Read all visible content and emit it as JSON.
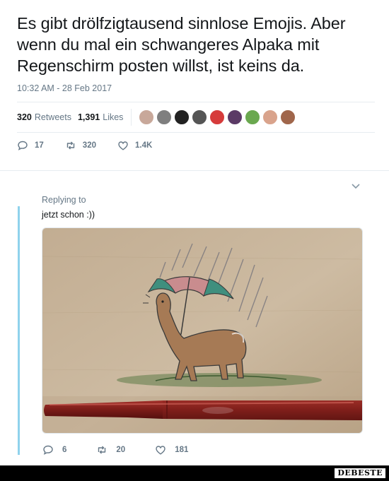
{
  "tweet": {
    "text": "Es gibt drölfzigtausend sinnlose Emojis. Aber wenn du mal ein schwangeres Alpaka mit Regenschirm posten willst, ist keins da.",
    "timestamp": "10:32 AM - 28 Feb 2017"
  },
  "stats": {
    "retweets_count": "320",
    "retweets_label": "Retweets",
    "likes_count": "1,391",
    "likes_label": "Likes"
  },
  "avatars": [
    {
      "color": "#c8a89a"
    },
    {
      "color": "#7f7f7f"
    },
    {
      "color": "#222222"
    },
    {
      "color": "#555555"
    },
    {
      "color": "#d63b3b"
    },
    {
      "color": "#5b3a66"
    },
    {
      "color": "#6aa84f"
    },
    {
      "color": "#d9a38c"
    },
    {
      "color": "#a0664b"
    }
  ],
  "actions": {
    "replies": "17",
    "retweets": "320",
    "likes": "1.4K"
  },
  "reply": {
    "replying_label": "Replying to",
    "text": "jetzt schon :))",
    "actions": {
      "replies": "6",
      "retweets": "20",
      "likes": "181"
    }
  },
  "footer": {
    "brand": "DEBESTE"
  },
  "colors": {
    "text": "#14171a",
    "muted": "#657786",
    "thread": "#8fd2ec",
    "cardboard": "#c7b49a"
  }
}
